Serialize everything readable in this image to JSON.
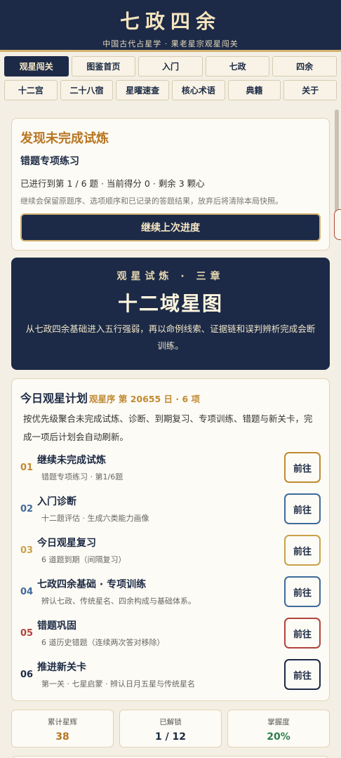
{
  "header": {
    "title": "七政四余",
    "subtitle": "中国古代占星学 · 果老星宗观星闯关"
  },
  "nav": {
    "row1": [
      "观星闯关",
      "图鉴首页",
      "入门",
      "七政",
      "四余"
    ],
    "row2": [
      "十二宫",
      "二十八宿",
      "星曜速查",
      "核心术语",
      "典籍",
      "关于"
    ],
    "active": "观星闯关"
  },
  "resume": {
    "title": "发现未完成试炼",
    "subtitle": "错题专项练习",
    "progress": "已进行到第 1 / 6 题 · 当前得分 0 · 剩余 3 颗心",
    "note": "继续会保留原题序、选项顺序和已记录的答题结果，放弃后将清除本局快照。",
    "button": "继续上次进度"
  },
  "chapter": {
    "kicker": "观星试炼 · 三章",
    "title": "十二域星图",
    "description": "从七政四余基础进入五行强弱，再以命例线索、证据链和误判辨析完成会断训练。"
  },
  "plan": {
    "title": "今日观星计划",
    "meta": "观星序 第 20655 日 · 6 项",
    "description": "按优先级聚合未完成试炼、诊断、到期复习、专项训练、错题与新关卡，完成一项后计划会自动刷新。",
    "go_label": "前往",
    "tasks": [
      {
        "num": "01",
        "name": "继续未完成试炼",
        "detail": "错题专项练习 · 第1/6题",
        "color": "#c08a33"
      },
      {
        "num": "02",
        "name": "入门诊断",
        "detail": "十二题评估 · 生成六类能力画像",
        "color": "#3f6b9c"
      },
      {
        "num": "03",
        "name": "今日观星复习",
        "detail": "6 道题到期（间隔复习）",
        "color": "#c9a24a"
      },
      {
        "num": "04",
        "name": "七政四余基础 · 专项训练",
        "detail": "辨认七政、传统星名、四余构成与基础体系。",
        "color": "#3f6b9c"
      },
      {
        "num": "05",
        "name": "错题巩固",
        "detail": "6 道历史错题（连续两次答对移除）",
        "color": "#b0443d"
      },
      {
        "num": "06",
        "name": "推进新关卡",
        "detail": "第一关 · 七星启蒙 · 辨认日月五星与传统星名",
        "color": "#1c2a47"
      }
    ]
  },
  "stats": [
    {
      "label": "累计星辉",
      "value": "38",
      "color": "#b77623"
    },
    {
      "label": "已解锁",
      "value": "1 / 12",
      "color": "#1c2a44"
    },
    {
      "label": "掌握度",
      "value": "20%",
      "color": "#2e7d4f"
    }
  ]
}
